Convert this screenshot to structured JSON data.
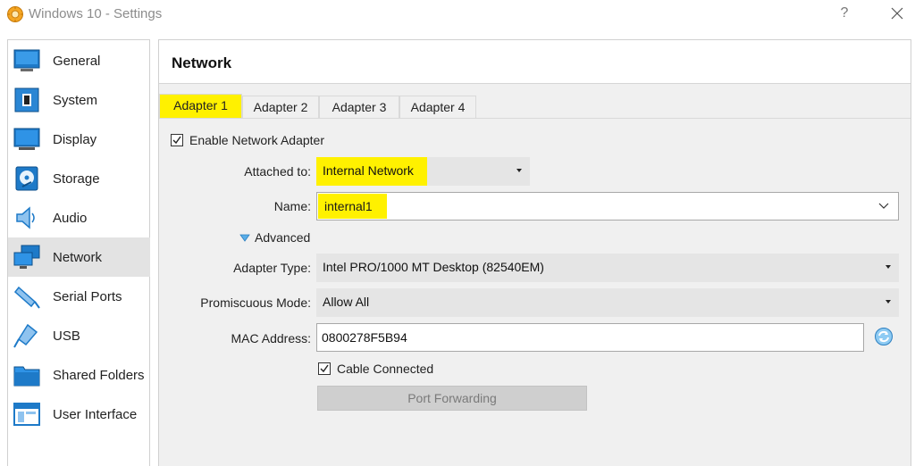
{
  "window": {
    "title": "Windows 10 - Settings",
    "help_label": "?"
  },
  "sidebar": {
    "items": [
      {
        "label": "General",
        "icon": "general-icon"
      },
      {
        "label": "System",
        "icon": "system-chip-icon"
      },
      {
        "label": "Display",
        "icon": "display-monitor-icon"
      },
      {
        "label": "Storage",
        "icon": "storage-disk-icon"
      },
      {
        "label": "Audio",
        "icon": "audio-speaker-icon"
      },
      {
        "label": "Network",
        "icon": "network-icon",
        "selected": true
      },
      {
        "label": "Serial Ports",
        "icon": "serial-port-icon"
      },
      {
        "label": "USB",
        "icon": "usb-icon"
      },
      {
        "label": "Shared Folders",
        "icon": "shared-folder-icon"
      },
      {
        "label": "User Interface",
        "icon": "user-interface-icon"
      }
    ]
  },
  "page": {
    "title": "Network"
  },
  "tabs": [
    "Adapter 1",
    "Adapter 2",
    "Adapter 3",
    "Adapter 4"
  ],
  "active_tab": "Adapter 1",
  "form": {
    "enable_adapter": {
      "label": "Enable Network Adapter",
      "checked": true
    },
    "attached_to": {
      "label": "Attached to:",
      "value": "Internal Network"
    },
    "name": {
      "label": "Name:",
      "value": "internal1"
    },
    "advanced": {
      "label": "Advanced",
      "expanded": true
    },
    "adapter_type": {
      "label": "Adapter Type:",
      "value": "Intel PRO/1000 MT Desktop (82540EM)"
    },
    "promiscuous_mode": {
      "label": "Promiscuous Mode:",
      "value": "Allow All"
    },
    "mac_address": {
      "label": "MAC Address:",
      "value": "0800278F5B94"
    },
    "cable_connected": {
      "label": "Cable Connected",
      "checked": true
    },
    "port_forwarding": {
      "label": "Port Forwarding",
      "enabled": false
    }
  },
  "colors": {
    "highlight": "#fff100",
    "selected_sidebar": "#e3e3e3",
    "panel_bg": "#f0f0f0",
    "icon_blue": "#1e7ac8"
  }
}
